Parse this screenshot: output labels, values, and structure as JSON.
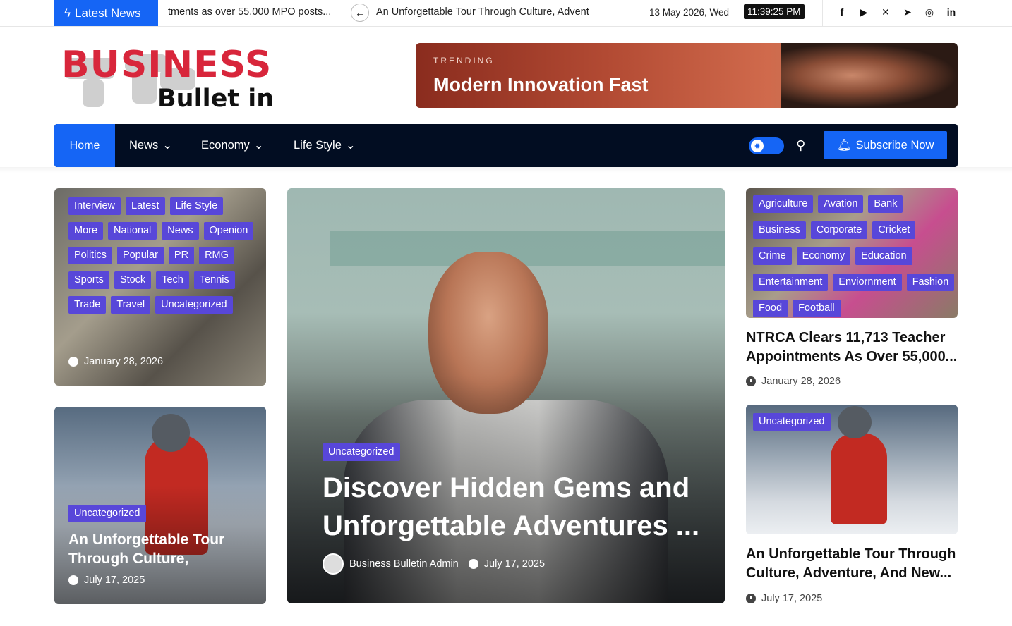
{
  "topbar": {
    "latest_label": "Latest News",
    "ticker_prev": "tments as over 55,000 MPO posts...",
    "ticker_current": "An Unforgettable Tour Through Culture, Advent",
    "date": "13 May 2026, Wed",
    "time": "11:39:25 PM",
    "social": [
      {
        "icon": "facebook-icon",
        "glyph": "f"
      },
      {
        "icon": "youtube-icon",
        "glyph": "▶"
      },
      {
        "icon": "x-twitter-icon",
        "glyph": "✕"
      },
      {
        "icon": "telegram-icon",
        "glyph": "➤"
      },
      {
        "icon": "instagram-icon",
        "glyph": "◎"
      },
      {
        "icon": "linkedin-icon",
        "glyph": "in"
      }
    ]
  },
  "logo": {
    "line1": "BUSINESS",
    "line2": "Bullet in"
  },
  "banner": {
    "kicker": "TRENDING",
    "title": "Modern Innovation Fast"
  },
  "nav": {
    "home": "Home",
    "items": [
      "News",
      "Economy",
      "Life Style"
    ],
    "subscribe": "Subscribe Now"
  },
  "cards": {
    "left_top": {
      "tags": [
        "Interview",
        "Latest",
        "Life Style",
        "More",
        "National",
        "News",
        "Openion",
        "Politics",
        "Popular",
        "PR",
        "RMG",
        "Sports",
        "Stock",
        "Tech",
        "Tennis",
        "Trade",
        "Travel",
        "Uncategorized"
      ],
      "date": "January 28, 2026"
    },
    "left_bottom": {
      "tag": "Uncategorized",
      "title": "An Unforgettable Tour Through Culture,",
      "date": "July 17, 2025"
    },
    "center": {
      "tag": "Uncategorized",
      "title": "Discover Hidden Gems and Unforgettable Adventures ...",
      "author": "Business Bulletin Admin",
      "date": "July 17, 2025"
    },
    "right_top": {
      "tags": [
        "Agriculture",
        "Avation",
        "Bank",
        "Business",
        "Corporate",
        "Cricket",
        "Crime",
        "Economy",
        "Education",
        "Entertainment",
        "Enviornment",
        "Fashion",
        "Food",
        "Football"
      ],
      "title": "NTRCA Clears 11,713 Teacher Appointments As Over 55,000...",
      "date": "January 28, 2026"
    },
    "right_bottom": {
      "tag": "Uncategorized",
      "title": "An Unforgettable Tour Through Culture, Adventure, And New...",
      "date": "July 17, 2025"
    }
  }
}
